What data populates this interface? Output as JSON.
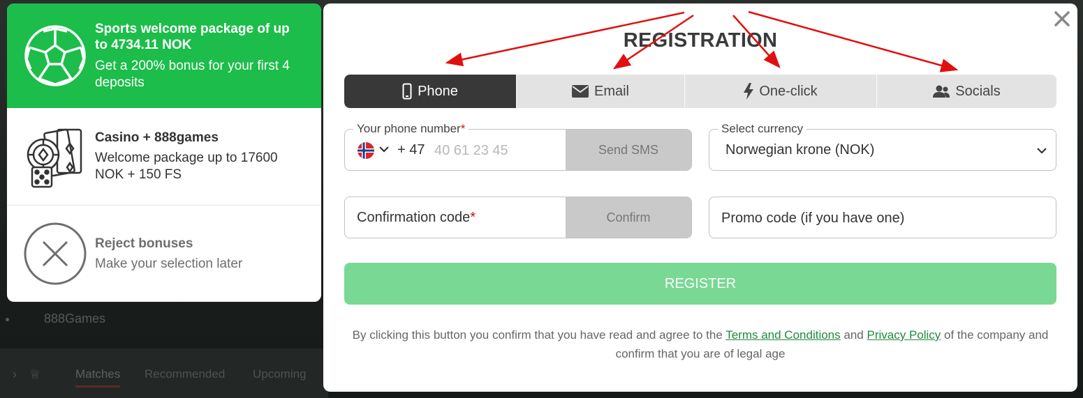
{
  "background": {
    "menu_item": "888Games",
    "tabs": [
      "Matches",
      "Recommended",
      "Upcoming"
    ]
  },
  "bonuses": [
    {
      "title": "Sports welcome package of up to 4734.11 NOK",
      "subtitle": "Get a 200% bonus for your first 4 deposits",
      "icon": "soccer-ball-icon"
    },
    {
      "title": "Casino + 888games",
      "subtitle": "Welcome package up to 17600 NOK + 150 FS",
      "icon": "casino-chips-cards-icon"
    },
    {
      "title": "Reject bonuses",
      "subtitle": "Make your selection later",
      "icon": "reject-icon"
    }
  ],
  "registration": {
    "title": "REGISTRATION",
    "tabs": [
      {
        "label": "Phone",
        "icon": "phone-icon",
        "active": true
      },
      {
        "label": "Email",
        "icon": "envelope-icon",
        "active": false
      },
      {
        "label": "One-click",
        "icon": "lightning-icon",
        "active": false
      },
      {
        "label": "Socials",
        "icon": "users-icon",
        "active": false
      }
    ],
    "phone": {
      "label": "Your phone number",
      "required_mark": "*",
      "country_flag": "Norway",
      "prefix": "+ 47",
      "placeholder": "40 61 23 45",
      "value": "",
      "send_sms_label": "Send SMS"
    },
    "currency": {
      "label": "Select currency",
      "selected": "Norwegian krone (NOK)"
    },
    "confirmation": {
      "placeholder": "Confirmation code",
      "required_mark": "*",
      "confirm_label": "Confirm"
    },
    "promo": {
      "placeholder": "Promo code (if you have one)"
    },
    "register_label": "REGISTER",
    "legal": {
      "part1": "By clicking this button you confirm that you have read and agree to the",
      "terms_link": "Terms and Conditions",
      "and": "and",
      "privacy_link": "Privacy Policy",
      "part2": "of the company and confirm that you are of legal age"
    }
  },
  "colors": {
    "green": "#1cbd4a",
    "register_green": "#79d893",
    "active_tab": "#383838",
    "annotation_arrow": "#e01010"
  }
}
